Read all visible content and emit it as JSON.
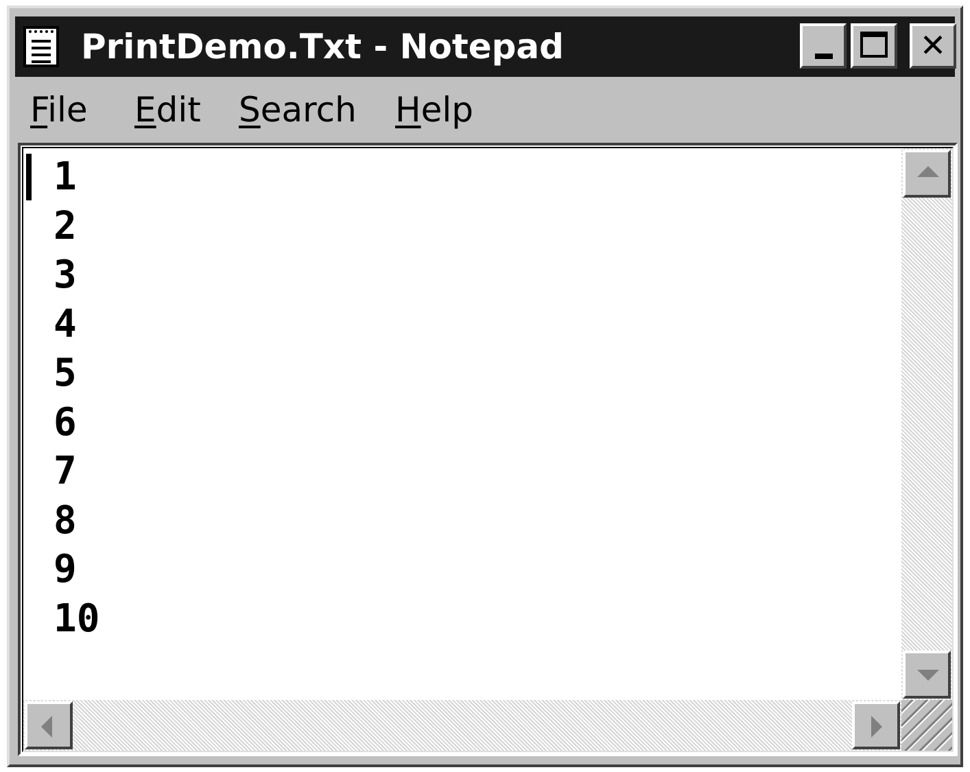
{
  "window": {
    "title": "PrintDemo.Txt - Notepad",
    "icon": "notepad-icon",
    "controls": {
      "minimize_icon": "minimize-icon",
      "maximize_icon": "maximize-icon",
      "close_glyph": "✕"
    }
  },
  "menu": {
    "items": [
      {
        "accel": "F",
        "rest": "ile"
      },
      {
        "accel": "E",
        "rest": "dit"
      },
      {
        "accel": "S",
        "rest": "earch"
      },
      {
        "accel": "H",
        "rest": "elp"
      }
    ]
  },
  "editor": {
    "lines": [
      "1",
      "2",
      "3",
      "4",
      "5",
      "6",
      "7",
      "8",
      "9",
      "10"
    ]
  },
  "colors": {
    "titlebar": "#1a1a1a",
    "face": "#c0c0c0",
    "text": "#000000"
  }
}
